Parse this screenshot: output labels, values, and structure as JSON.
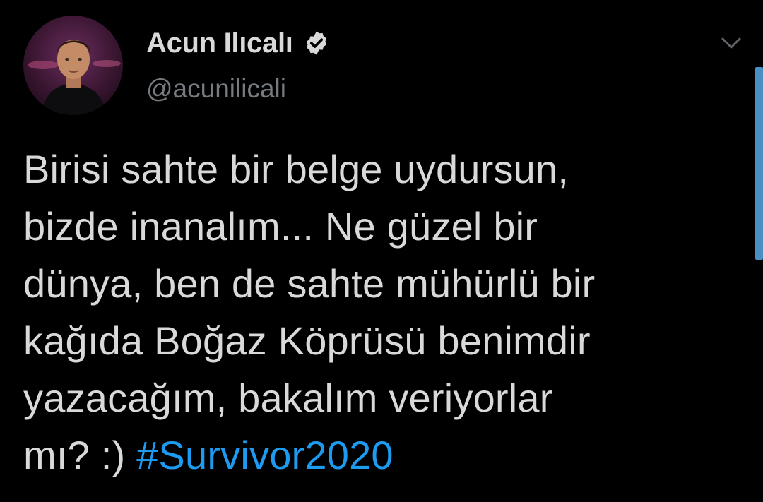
{
  "tweet": {
    "author": {
      "display_name": "Acun Ilıcalı",
      "handle": "@acunilicali",
      "verified": true,
      "avatar_icon": "profile-photo"
    },
    "text": {
      "line_1": "Birisi sahte bir belge uydursun,",
      "line_2": "bizde inanalım... Ne güzel bir",
      "line_3": "dünya, ben de sahte mühürlü bir",
      "line_4": "kağıda Boğaz Köprüsü benimdir",
      "line_5": "yazacağım, bakalım veriyorlar",
      "line_6_prefix": "mı? :) ",
      "hashtag": "#Survivor2020"
    },
    "menu_icon": "chevron-down-icon"
  },
  "colors": {
    "background": "#000000",
    "primary_text": "#d9d9d9",
    "secondary_text": "#767b80",
    "link": "#1d9bf0",
    "scrollbar": "#4a8fc4"
  }
}
